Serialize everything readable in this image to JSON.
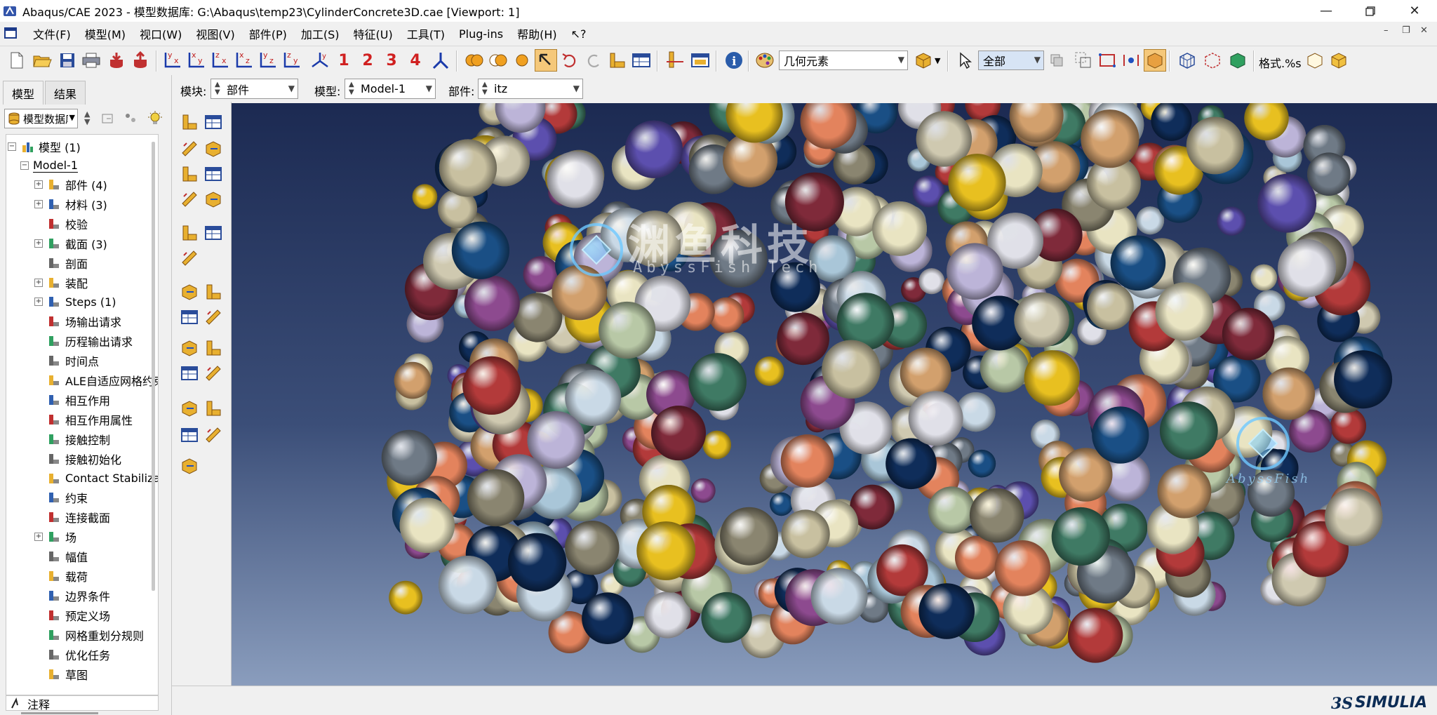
{
  "window": {
    "title": "Abaqus/CAE 2023 - 模型数据库: G:\\Abaqus\\temp23\\CylinderConcrete3D.cae [Viewport: 1]",
    "minimize_icon": "minimize-icon",
    "maximize_icon": "restore-icon",
    "close_icon": "close-icon"
  },
  "menu": {
    "items": [
      "文件(F)",
      "模型(M)",
      "视口(W)",
      "视图(V)",
      "部件(P)",
      "加工(S)",
      "特征(U)",
      "工具(T)",
      "Plug-ins",
      "帮助(H)",
      "⁇"
    ]
  },
  "toolbar": {
    "view_numbers": [
      "1",
      "2",
      "3",
      "4"
    ],
    "geometry_filter": "几何元素",
    "selection_filter": "全部",
    "style_label": "格式.%s"
  },
  "context": {
    "module_label": "模块:",
    "module_value": "部件",
    "model_label": "模型:",
    "model_value": "Model-1",
    "part_label": "部件:",
    "part_value": "itz"
  },
  "panel": {
    "tabs": [
      "模型",
      "结果"
    ],
    "db_combo": "模型数据库"
  },
  "tree": {
    "root": "模型 (1)",
    "model": "Model-1",
    "items": [
      {
        "label": "部件 (4)",
        "expandable": true,
        "icon": "part-icon"
      },
      {
        "label": "材料 (3)",
        "expandable": true,
        "icon": "material-icon"
      },
      {
        "label": "校验",
        "expandable": false,
        "icon": "calibration-icon"
      },
      {
        "label": "截面 (3)",
        "expandable": true,
        "icon": "section-icon"
      },
      {
        "label": "剖面",
        "expandable": false,
        "icon": "profile-icon"
      },
      {
        "label": "装配",
        "expandable": true,
        "icon": "assembly-icon"
      },
      {
        "label": "Steps (1)",
        "expandable": true,
        "icon": "steps-icon"
      },
      {
        "label": "场输出请求",
        "expandable": false,
        "icon": "field-output-icon"
      },
      {
        "label": "历程输出请求",
        "expandable": false,
        "icon": "history-output-icon"
      },
      {
        "label": "时间点",
        "expandable": false,
        "icon": "time-points-icon"
      },
      {
        "label": "ALE自适应网格约束",
        "expandable": false,
        "icon": "ale-icon"
      },
      {
        "label": "相互作用",
        "expandable": false,
        "icon": "interaction-icon"
      },
      {
        "label": "相互作用属性",
        "expandable": false,
        "icon": "interaction-property-icon"
      },
      {
        "label": "接触控制",
        "expandable": false,
        "icon": "contact-control-icon"
      },
      {
        "label": "接触初始化",
        "expandable": false,
        "icon": "contact-init-icon"
      },
      {
        "label": "Contact Stabilization",
        "expandable": false,
        "icon": "contact-stabilization-icon"
      },
      {
        "label": "约束",
        "expandable": false,
        "icon": "constraint-icon"
      },
      {
        "label": "连接截面",
        "expandable": false,
        "icon": "connector-section-icon"
      },
      {
        "label": "场",
        "expandable": true,
        "icon": "field-icon"
      },
      {
        "label": "幅值",
        "expandable": false,
        "icon": "amplitude-icon"
      },
      {
        "label": "载荷",
        "expandable": false,
        "icon": "load-icon"
      },
      {
        "label": "边界条件",
        "expandable": false,
        "icon": "bc-icon"
      },
      {
        "label": "预定义场",
        "expandable": false,
        "icon": "predefined-field-icon"
      },
      {
        "label": "网格重划分规则",
        "expandable": false,
        "icon": "remesh-icon"
      },
      {
        "label": "优化任务",
        "expandable": false,
        "icon": "optimization-icon"
      },
      {
        "label": "草图",
        "expandable": false,
        "icon": "sketch-icon"
      }
    ],
    "footer": "注释"
  },
  "viewport": {
    "watermark_cn": "渊鱼科技",
    "watermark_en": "AbyssFish Tech",
    "watermark_small": "AbyssFish",
    "sphere_colors": [
      "#e9e4c2",
      "#c9d9e6",
      "#a9c6d8",
      "#7f2a3a",
      "#1a4f85",
      "#0f2d5a",
      "#b33a3a",
      "#d2a06d",
      "#e3835d",
      "#e8c020",
      "#8d4a8f",
      "#5c4fae",
      "#6f7a86",
      "#b8c8a6",
      "#cfc9b0",
      "#3f7a64",
      "#8a8570",
      "#e0e0e8",
      "#bcb4d8",
      "#c8c0a0"
    ],
    "brand": "SIMULIA"
  }
}
